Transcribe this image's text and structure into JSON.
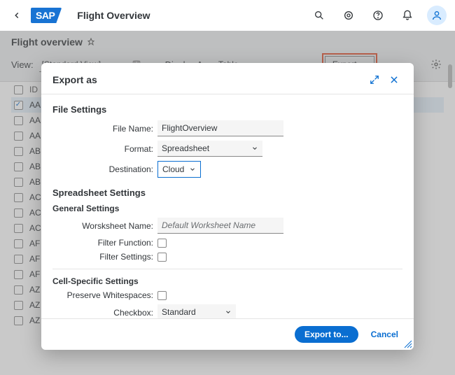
{
  "header": {
    "logo_text": "SAP",
    "title": "Flight Overview"
  },
  "subheader": {
    "object_title": "Flight overview"
  },
  "toolbar": {
    "view_label": "View:",
    "view_value": "[Standard View]",
    "display_as_label": "Display As:",
    "display_as_value": "Table",
    "export_label": "Export"
  },
  "table": {
    "header": "ID",
    "rows": [
      {
        "id": "AA",
        "selected": true
      },
      {
        "id": "AA",
        "selected": false
      },
      {
        "id": "AA",
        "selected": false
      },
      {
        "id": "AB",
        "selected": false
      },
      {
        "id": "AB",
        "selected": false
      },
      {
        "id": "AB",
        "selected": false
      },
      {
        "id": "AC",
        "selected": false
      },
      {
        "id": "AC",
        "selected": false
      },
      {
        "id": "AC",
        "selected": false
      },
      {
        "id": "AF",
        "selected": false
      },
      {
        "id": "AF",
        "selected": false
      },
      {
        "id": "AF",
        "selected": false
      },
      {
        "id": "AZ",
        "selected": false
      },
      {
        "id": "AZ",
        "selected": false
      },
      {
        "id": "AZ",
        "selected": false
      }
    ]
  },
  "dialog": {
    "title": "Export as",
    "file_settings_title": "File Settings",
    "file_name_label": "File Name:",
    "file_name_value": "FlightOverview",
    "format_label": "Format:",
    "format_value": "Spreadsheet",
    "destination_label": "Destination:",
    "destination_value": "Cloud",
    "spreadsheet_settings_title": "Spreadsheet Settings",
    "general_settings_title": "General Settings",
    "worksheet_name_label": "Worsksheet Name:",
    "worksheet_name_placeholder": "Default Worksheet Name",
    "filter_function_label": "Filter Function:",
    "filter_settings_label": "Filter Settings:",
    "cell_specific_title": "Cell-Specific Settings",
    "preserve_whitespaces_label": "Preserve Whitespaces:",
    "checkbox_label": "Checkbox:",
    "checkbox_value": "Standard",
    "footer": {
      "primary": "Export to...",
      "cancel": "Cancel"
    }
  }
}
